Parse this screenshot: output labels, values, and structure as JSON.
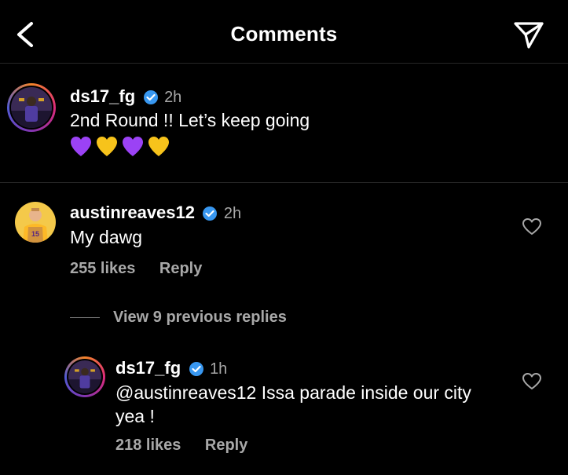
{
  "header": {
    "title": "Comments"
  },
  "caption": {
    "username": "ds17_fg",
    "time": "2h",
    "text": "2nd Round !! Let’s keep going",
    "emojis": [
      "purple-heart",
      "yellow-heart",
      "purple-heart",
      "yellow-heart"
    ]
  },
  "comment": {
    "username": "austinreaves12",
    "time": "2h",
    "text": "My dawg",
    "likes": "255 likes",
    "reply_label": "Reply",
    "view_replies": "View 9 previous replies"
  },
  "reply": {
    "username": "ds17_fg",
    "time": "1h",
    "text": "@austinreaves12 Issa parade inside our city yea !",
    "likes": "218 likes",
    "reply_label": "Reply"
  },
  "colors": {
    "background": "#000000",
    "secondary_text": "#a8a8a8",
    "verified_blue": "#3897f0",
    "purple_heart": "#9b42f5",
    "yellow_heart": "#f7c31b"
  }
}
